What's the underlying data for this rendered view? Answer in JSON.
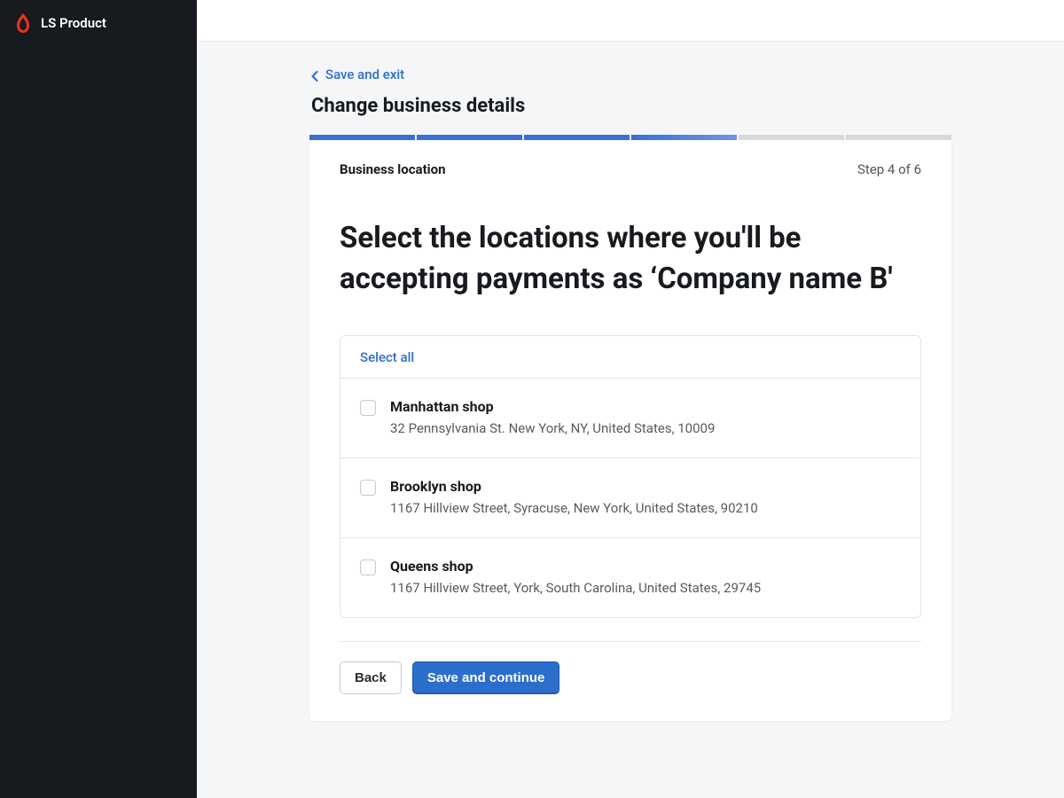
{
  "brand": {
    "name": "LS Product"
  },
  "header": {
    "save_exit_label": "Save and exit",
    "page_title": "Change business details"
  },
  "wizard": {
    "step_label": "Business location",
    "step_count_text": "Step 4 of 6",
    "headline": "Select the locations where you'll be accepting payments as ‘Company name B'",
    "progress": {
      "total": 6,
      "current": 4
    }
  },
  "locations": {
    "select_all_label": "Select all",
    "items": [
      {
        "name": "Manhattan shop",
        "address": "32 Pennsylvania St. New York, NY, United States, 10009",
        "checked": false
      },
      {
        "name": "Brooklyn shop",
        "address": "1167 Hillview Street, Syracuse, New York, United States, 90210",
        "checked": false
      },
      {
        "name": "Queens shop",
        "address": "1167 Hillview Street, York, South Carolina, United States, 29745",
        "checked": false
      }
    ]
  },
  "actions": {
    "back_label": "Back",
    "continue_label": "Save and continue"
  }
}
